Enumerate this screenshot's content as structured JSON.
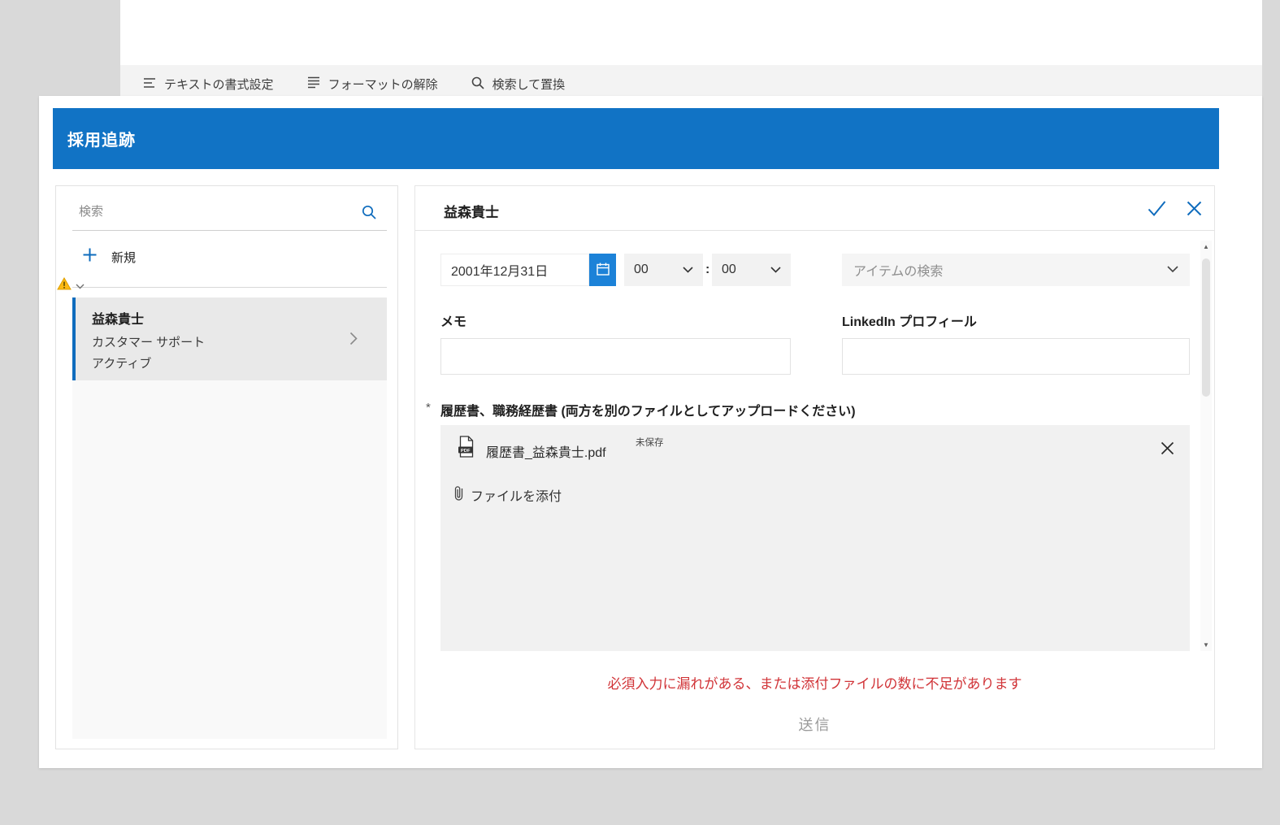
{
  "colors": {
    "accent": "#0f6cbd",
    "header_blue": "#1173c5",
    "calendar_button_blue": "#1c82d8",
    "warning_yellow": "#fdb913",
    "error_red": "#d13438"
  },
  "toolbar": {
    "items": [
      {
        "label": "テキストの書式設定"
      },
      {
        "label": "フォーマットの解除"
      },
      {
        "label": "検索して置換"
      }
    ]
  },
  "app": {
    "title": "採用追跡"
  },
  "sidebar": {
    "search_placeholder": "検索",
    "new_label": "新規",
    "selected_item": {
      "name": "益森貴士",
      "role": "カスタマー サポート",
      "status": "アクティブ"
    }
  },
  "form": {
    "title": "益森貴士",
    "fields": {
      "date_value": "2001年12月31日",
      "hour_value": "00",
      "time_separator": ":",
      "minute_value": "00",
      "item_search_placeholder": "アイテムの検索",
      "memo_label": "メモ",
      "linkedin_label": "LinkedIn プロフィール"
    },
    "attachments": {
      "required_marker": "*",
      "label": "履歴書、職務経歴書 (両方を別のファイルとしてアップロードください)",
      "file_name": "履歴書_益森貴士.pdf",
      "file_status": "未保存",
      "pdf_badge": "PDF",
      "attach_label": "ファイルを添付"
    },
    "error_message": "必須入力に漏れがある、または添付ファイルの数に不足があります",
    "submit_label": "送信"
  },
  "icons": {
    "scroll_up_glyph": "▲",
    "scroll_down_glyph": "▼"
  }
}
